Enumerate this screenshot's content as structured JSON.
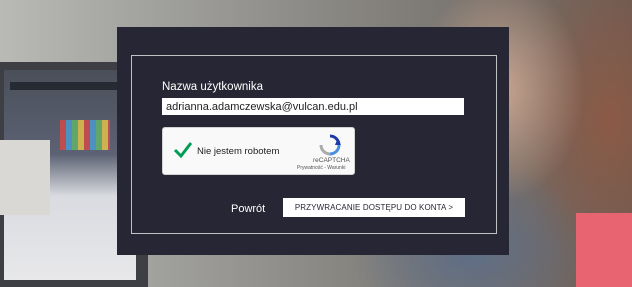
{
  "form": {
    "username_label": "Nazwa użytkownika",
    "username_value": "adrianna.adamczewska@vulcan.edu.pl",
    "back_label": "Powrót",
    "recover_label": "PRZYWRACANIE DOSTĘPU DO KONTA >"
  },
  "captcha": {
    "checkbox_label": "Nie jestem robotem",
    "brand": "reCAPTCHA",
    "links": "Prywatność - Warunki",
    "checked": true,
    "check_color": "#009e55"
  },
  "colors": {
    "panel": "#272634",
    "accent_pink": "#e86470"
  }
}
